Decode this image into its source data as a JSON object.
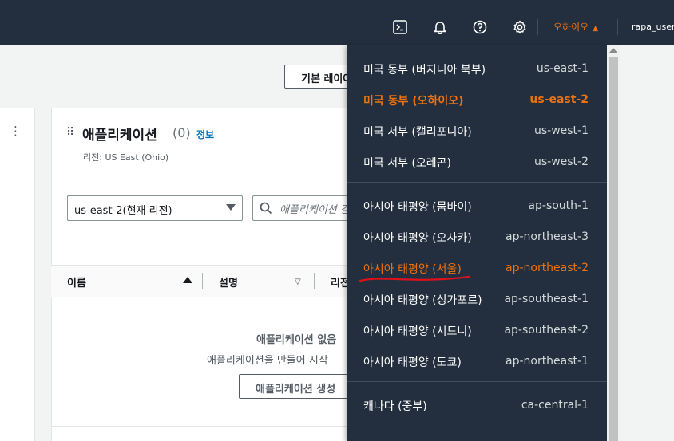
{
  "header": {
    "region_label": "오하이오",
    "region_caret": "▲",
    "user_label": "rapa_user"
  },
  "console": {
    "layout_button": "기본 레이아웃",
    "widget": {
      "title": "애플리케이션",
      "count": "(0)",
      "info_link": "정보",
      "subtitle": "리전: US East (Ohio)",
      "region_select_value": "us-east-2(현재 리전)",
      "search_placeholder": "애플리케이션 검색",
      "columns": [
        "이름",
        "설명",
        "리전"
      ],
      "empty_title": "애플리케이션 없음",
      "empty_subtitle": "애플리케이션을 만들어 시작",
      "create_button": "애플리케이션 생성"
    }
  },
  "region_menu": {
    "groups": [
      {
        "items": [
          {
            "name": "미국 동부 (버지니아 북부)",
            "code": "us-east-1",
            "state": "normal"
          },
          {
            "name": "미국 동부 (오하이오)",
            "code": "us-east-2",
            "state": "active"
          },
          {
            "name": "미국 서부 (캘리포니아)",
            "code": "us-west-1",
            "state": "normal"
          },
          {
            "name": "미국 서부 (오레곤)",
            "code": "us-west-2",
            "state": "normal"
          }
        ]
      },
      {
        "items": [
          {
            "name": "아시아 태평양 (뭄바이)",
            "code": "ap-south-1",
            "state": "normal"
          },
          {
            "name": "아시아 태평양 (오사카)",
            "code": "ap-northeast-3",
            "state": "normal"
          },
          {
            "name": "아시아 태평양 (서울)",
            "code": "ap-northeast-2",
            "state": "highlighted"
          },
          {
            "name": "아시아 태평양 (싱가포르)",
            "code": "ap-southeast-1",
            "state": "normal"
          },
          {
            "name": "아시아 태평양 (시드니)",
            "code": "ap-southeast-2",
            "state": "normal"
          },
          {
            "name": "아시아 태평양 (도쿄)",
            "code": "ap-northeast-1",
            "state": "normal"
          }
        ]
      },
      {
        "items": [
          {
            "name": "캐나다 (중부)",
            "code": "ca-central-1",
            "state": "normal"
          }
        ]
      }
    ]
  },
  "colors": {
    "nav_bg": "#232f3e",
    "accent": "#ec7211",
    "link": "#0073bb",
    "annotation_underline": "#e0101a"
  }
}
